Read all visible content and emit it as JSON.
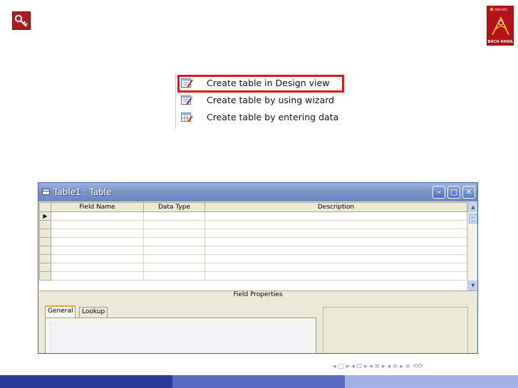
{
  "slide": {
    "logo": {
      "top_text": "ĐẠI HỌC",
      "bottom_text": "BÁCH KHOA"
    }
  },
  "menu": {
    "items": [
      {
        "label": "Create table in Design view",
        "icon": "design-view-icon",
        "highlighted": true
      },
      {
        "label": "Create table by using wizard",
        "icon": "wizard-icon",
        "highlighted": false
      },
      {
        "label": "Create table by entering data",
        "icon": "datasheet-icon",
        "highlighted": false
      }
    ],
    "highlight_color": "#e3141a"
  },
  "window": {
    "title": "Table1 : Table",
    "columns": [
      "Field Name",
      "Data Type",
      "Description"
    ],
    "row_count": 8,
    "current_row_marker": "▶",
    "scroll_up": "▲",
    "scroll_down": "▼",
    "field_properties_label": "Field Properties",
    "tabs": [
      {
        "label": "General",
        "active": true
      },
      {
        "label": "Lookup",
        "active": false
      }
    ],
    "titlebar_color": "#7b93c7"
  },
  "nav": {
    "symbols": "◂ □ ▸ ◂ ⊡ ▸ ◂ ≡ ▸ ◂ ≡ ▸ ≡ ⟲⟳"
  },
  "band_colors": [
    "#2b3a96",
    "#5a6ac4",
    "#a4b1e6"
  ]
}
